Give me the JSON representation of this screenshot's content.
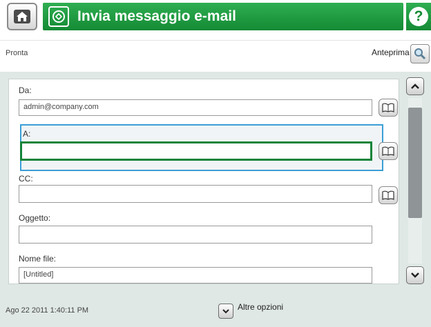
{
  "header": {
    "title": "Invia messaggio e-mail",
    "accent_color": "#1f9c43",
    "icons": [
      "home-icon",
      "email-icon",
      "help-icon"
    ]
  },
  "status": {
    "text": "Pronta",
    "preview_label": "Anteprima"
  },
  "form": {
    "from": {
      "label": "Da:",
      "value": "admin@company.com"
    },
    "to": {
      "label": "A:",
      "value": ""
    },
    "cc": {
      "label": "CC:",
      "value": ""
    },
    "subject": {
      "label": "Oggetto:",
      "value": ""
    },
    "filename": {
      "label": "Nome file:",
      "value": "[Untitled]"
    }
  },
  "footer": {
    "datetime": "Ago 22 2011 1:40:11 PM",
    "more_options": "Altre opzioni"
  }
}
